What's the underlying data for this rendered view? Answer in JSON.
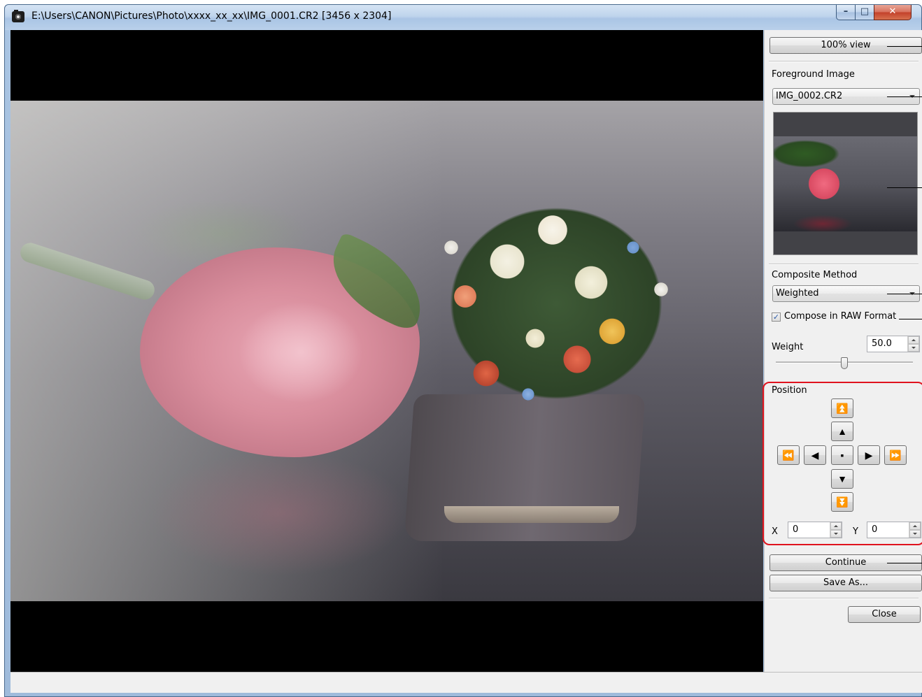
{
  "window": {
    "title": "E:\\Users\\CANON\\Pictures\\Photo\\xxxx_xx_xx\\IMG_0001.CR2 [3456 x 2304]",
    "minimize_glyph": "–",
    "maximize_glyph": "□",
    "close_glyph": "✕"
  },
  "panel": {
    "view_button": "100% view",
    "foreground_label": "Foreground Image",
    "foreground_value": "IMG_0002.CR2",
    "composite_label": "Composite Method",
    "composite_value": "Weighted",
    "raw_checkbox_label": "Compose in RAW Format",
    "raw_checked": true,
    "raw_check_glyph": "✓",
    "weight_label": "Weight",
    "weight_value": "50.0",
    "weight_fraction": 0.5,
    "position_label": "Position",
    "x_label": "X",
    "x_value": "0",
    "y_label": "Y",
    "y_value": "0",
    "continue_button": "Continue",
    "save_as_button": "Save As...",
    "close_button": "Close"
  },
  "nav_glyphs": {
    "up_fast": "⏫",
    "up": "▲",
    "left_fast": "⏪",
    "left": "◀",
    "center": "▪",
    "right": "▶",
    "right_fast": "⏩",
    "down": "▼",
    "down_fast": "⏬"
  },
  "colors": {
    "highlight_border": "#e0131e",
    "checkbox_mark": "#2a5aa8"
  },
  "icons": {
    "app_icon": "camera-icon"
  }
}
